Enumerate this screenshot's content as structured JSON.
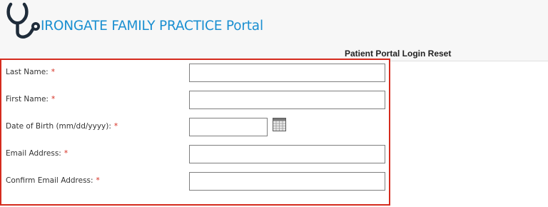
{
  "header": {
    "brand": "IRONGATE FAMILY PRACTICE Portal",
    "logo_icon": "stethoscope-icon",
    "brand_color": "#1a8fd1",
    "page_heading": "Patient Portal Login Reset"
  },
  "form": {
    "border_color": "#d52b1e",
    "required_marker": "*",
    "fields": [
      {
        "label": "Last Name:",
        "value": "",
        "required": true
      },
      {
        "label": "First Name:",
        "value": "",
        "required": true
      },
      {
        "label": "Date of Birth (mm/dd/yyyy):",
        "value": "",
        "required": true,
        "calendar_icon": "calendar-icon"
      },
      {
        "label": "Email Address:",
        "value": "",
        "required": true
      },
      {
        "label": "Confirm Email Address:",
        "value": "",
        "required": true
      }
    ]
  }
}
